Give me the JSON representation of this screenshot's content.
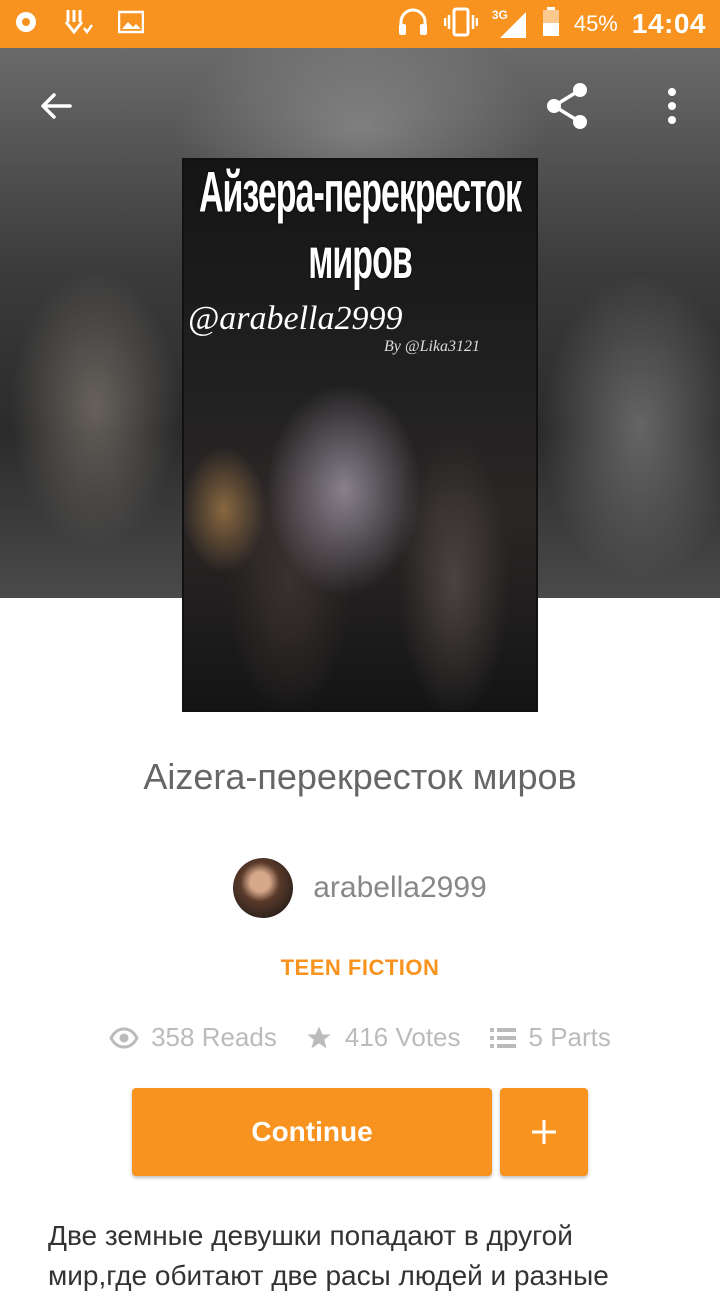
{
  "status_bar": {
    "battery_percent": "45%",
    "network": "3G",
    "time": "14:04",
    "icons_left": [
      "media-icon",
      "download-icon",
      "image-icon"
    ],
    "icons_right": [
      "headset-icon",
      "vibrate-icon",
      "signal-icon",
      "battery-icon"
    ]
  },
  "toolbar": {
    "back_icon": "arrow-left-icon",
    "share_icon": "share-icon",
    "more_icon": "more-vertical-icon"
  },
  "cover": {
    "title_text": "Айзера-перекресток миров",
    "author_text": "@arabella2999",
    "credit_text": "By @Lika3121"
  },
  "story": {
    "title": "Aizera-перекресток миров",
    "author": "arabella2999",
    "genre": "TEEN FICTION",
    "reads": "358 Reads",
    "votes": "416 Votes",
    "parts": "5 Parts",
    "continue_label": "Continue",
    "add_icon": "plus-icon",
    "description": "Две земные девушки попадают в другой мир,где обитают две расы людей и разные"
  },
  "colors": {
    "accent": "#f7931e",
    "title_gray": "#666666",
    "meta_gray": "#bbbbbb"
  }
}
